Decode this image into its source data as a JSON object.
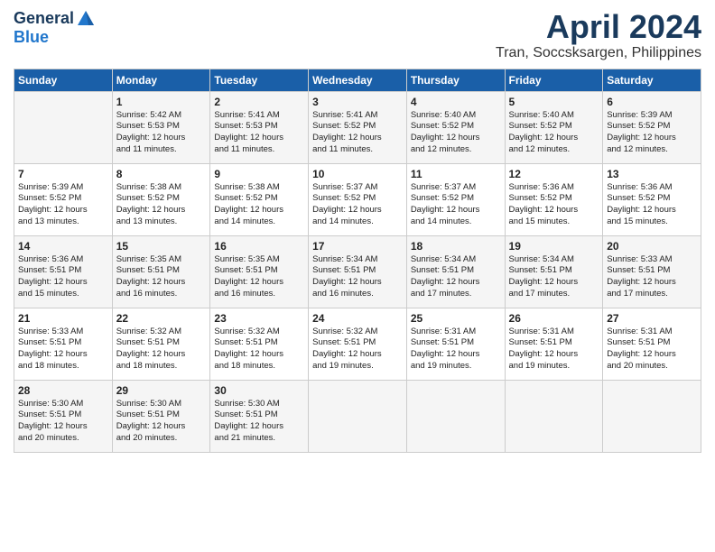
{
  "header": {
    "logo_general": "General",
    "logo_blue": "Blue",
    "month_year": "April 2024",
    "location": "Tran, Soccsksargen, Philippines"
  },
  "days_of_week": [
    "Sunday",
    "Monday",
    "Tuesday",
    "Wednesday",
    "Thursday",
    "Friday",
    "Saturday"
  ],
  "weeks": [
    [
      {
        "day": "",
        "content": ""
      },
      {
        "day": "1",
        "content": "Sunrise: 5:42 AM\nSunset: 5:53 PM\nDaylight: 12 hours\nand 11 minutes."
      },
      {
        "day": "2",
        "content": "Sunrise: 5:41 AM\nSunset: 5:53 PM\nDaylight: 12 hours\nand 11 minutes."
      },
      {
        "day": "3",
        "content": "Sunrise: 5:41 AM\nSunset: 5:52 PM\nDaylight: 12 hours\nand 11 minutes."
      },
      {
        "day": "4",
        "content": "Sunrise: 5:40 AM\nSunset: 5:52 PM\nDaylight: 12 hours\nand 12 minutes."
      },
      {
        "day": "5",
        "content": "Sunrise: 5:40 AM\nSunset: 5:52 PM\nDaylight: 12 hours\nand 12 minutes."
      },
      {
        "day": "6",
        "content": "Sunrise: 5:39 AM\nSunset: 5:52 PM\nDaylight: 12 hours\nand 12 minutes."
      }
    ],
    [
      {
        "day": "7",
        "content": "Sunrise: 5:39 AM\nSunset: 5:52 PM\nDaylight: 12 hours\nand 13 minutes."
      },
      {
        "day": "8",
        "content": "Sunrise: 5:38 AM\nSunset: 5:52 PM\nDaylight: 12 hours\nand 13 minutes."
      },
      {
        "day": "9",
        "content": "Sunrise: 5:38 AM\nSunset: 5:52 PM\nDaylight: 12 hours\nand 14 minutes."
      },
      {
        "day": "10",
        "content": "Sunrise: 5:37 AM\nSunset: 5:52 PM\nDaylight: 12 hours\nand 14 minutes."
      },
      {
        "day": "11",
        "content": "Sunrise: 5:37 AM\nSunset: 5:52 PM\nDaylight: 12 hours\nand 14 minutes."
      },
      {
        "day": "12",
        "content": "Sunrise: 5:36 AM\nSunset: 5:52 PM\nDaylight: 12 hours\nand 15 minutes."
      },
      {
        "day": "13",
        "content": "Sunrise: 5:36 AM\nSunset: 5:52 PM\nDaylight: 12 hours\nand 15 minutes."
      }
    ],
    [
      {
        "day": "14",
        "content": "Sunrise: 5:36 AM\nSunset: 5:51 PM\nDaylight: 12 hours\nand 15 minutes."
      },
      {
        "day": "15",
        "content": "Sunrise: 5:35 AM\nSunset: 5:51 PM\nDaylight: 12 hours\nand 16 minutes."
      },
      {
        "day": "16",
        "content": "Sunrise: 5:35 AM\nSunset: 5:51 PM\nDaylight: 12 hours\nand 16 minutes."
      },
      {
        "day": "17",
        "content": "Sunrise: 5:34 AM\nSunset: 5:51 PM\nDaylight: 12 hours\nand 16 minutes."
      },
      {
        "day": "18",
        "content": "Sunrise: 5:34 AM\nSunset: 5:51 PM\nDaylight: 12 hours\nand 17 minutes."
      },
      {
        "day": "19",
        "content": "Sunrise: 5:34 AM\nSunset: 5:51 PM\nDaylight: 12 hours\nand 17 minutes."
      },
      {
        "day": "20",
        "content": "Sunrise: 5:33 AM\nSunset: 5:51 PM\nDaylight: 12 hours\nand 17 minutes."
      }
    ],
    [
      {
        "day": "21",
        "content": "Sunrise: 5:33 AM\nSunset: 5:51 PM\nDaylight: 12 hours\nand 18 minutes."
      },
      {
        "day": "22",
        "content": "Sunrise: 5:32 AM\nSunset: 5:51 PM\nDaylight: 12 hours\nand 18 minutes."
      },
      {
        "day": "23",
        "content": "Sunrise: 5:32 AM\nSunset: 5:51 PM\nDaylight: 12 hours\nand 18 minutes."
      },
      {
        "day": "24",
        "content": "Sunrise: 5:32 AM\nSunset: 5:51 PM\nDaylight: 12 hours\nand 19 minutes."
      },
      {
        "day": "25",
        "content": "Sunrise: 5:31 AM\nSunset: 5:51 PM\nDaylight: 12 hours\nand 19 minutes."
      },
      {
        "day": "26",
        "content": "Sunrise: 5:31 AM\nSunset: 5:51 PM\nDaylight: 12 hours\nand 19 minutes."
      },
      {
        "day": "27",
        "content": "Sunrise: 5:31 AM\nSunset: 5:51 PM\nDaylight: 12 hours\nand 20 minutes."
      }
    ],
    [
      {
        "day": "28",
        "content": "Sunrise: 5:30 AM\nSunset: 5:51 PM\nDaylight: 12 hours\nand 20 minutes."
      },
      {
        "day": "29",
        "content": "Sunrise: 5:30 AM\nSunset: 5:51 PM\nDaylight: 12 hours\nand 20 minutes."
      },
      {
        "day": "30",
        "content": "Sunrise: 5:30 AM\nSunset: 5:51 PM\nDaylight: 12 hours\nand 21 minutes."
      },
      {
        "day": "",
        "content": ""
      },
      {
        "day": "",
        "content": ""
      },
      {
        "day": "",
        "content": ""
      },
      {
        "day": "",
        "content": ""
      }
    ]
  ]
}
